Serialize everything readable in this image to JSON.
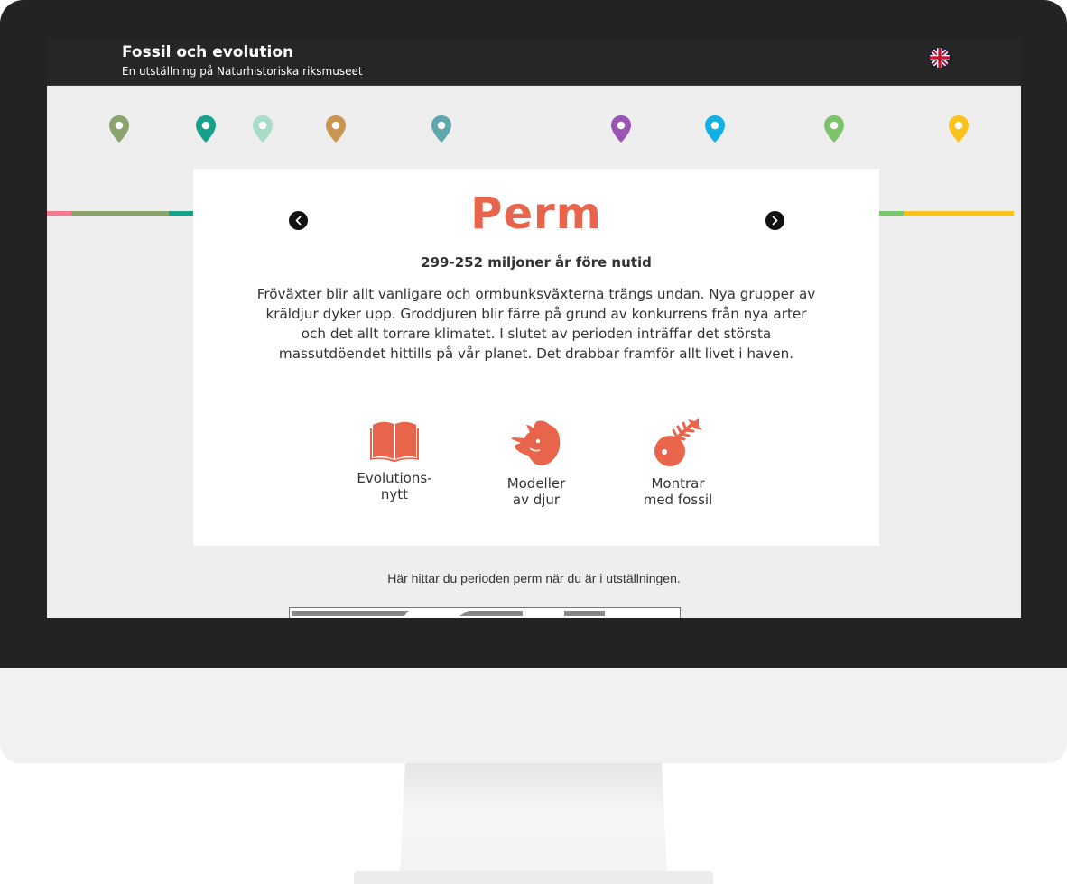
{
  "header": {
    "title": "Fossil och evolution",
    "subtitle": "En utställning på Naturhistoriska riksmuseet",
    "language_icon": "uk-flag-icon"
  },
  "timeline": {
    "pins": [
      {
        "color": "#8ba36c"
      },
      {
        "color": "#17a08a"
      },
      {
        "color": "#a8dcc6"
      },
      {
        "color": "#c9954f"
      },
      {
        "color": "#5ea7ad"
      },
      {
        "color": "#9a55b3"
      },
      {
        "color": "#13b0e6"
      },
      {
        "color": "#7cc46b"
      },
      {
        "color": "#fbc11c"
      }
    ],
    "segments": [
      {
        "color": "#f47b8d"
      },
      {
        "color": "#8ba36c"
      },
      {
        "color": "#17a08a"
      },
      {
        "color": "#a8dcc6"
      },
      {
        "color": "#c9954f"
      },
      {
        "color": "#5ea7ad"
      },
      {
        "color": "#e8644a"
      },
      {
        "color": "#9a55b3"
      },
      {
        "color": "#13b0e6"
      },
      {
        "color": "#7cc46b"
      },
      {
        "color": "#fbc11c"
      }
    ],
    "active_color": "#e8644a"
  },
  "period": {
    "name": "Perm",
    "dates": "299-252 miljoner år före nutid",
    "description": "Fröväxter blir allt vanligare och ormbunksväxterna trängs undan. Nya grupper av kräldjur dyker upp. Groddjuren blir färre på grund av konkurrens från nya arter och det allt torrare klimatet. I slutet av perioden inträffar det största massutdöendet hittills på vår planet. Det drabbar framför allt livet i haven.",
    "prev_icon": "chevron-left-icon",
    "next_icon": "chevron-right-icon"
  },
  "features": [
    {
      "icon": "book-icon",
      "line1": "Evolutions-",
      "line2": "nytt"
    },
    {
      "icon": "triceratops-icon",
      "line1": "Modeller",
      "line2": "av djur"
    },
    {
      "icon": "fish-fossil-icon",
      "line1": "Montrar",
      "line2": "med fossil"
    }
  ],
  "location": {
    "text": "Här hittar du perioden perm när du är i utställningen."
  }
}
